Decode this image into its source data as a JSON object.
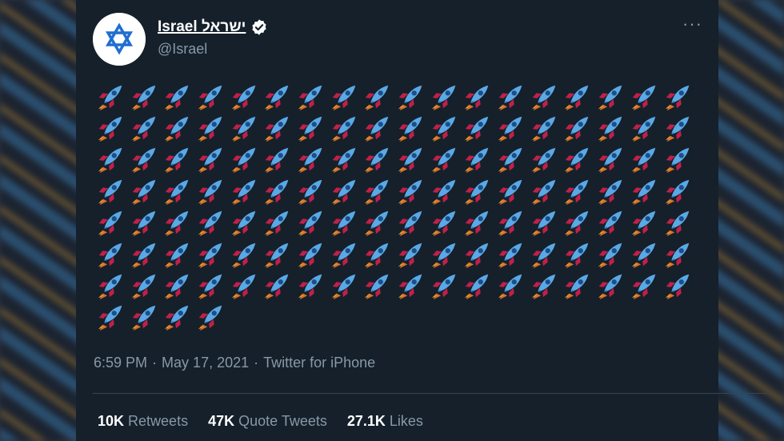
{
  "account": {
    "name": "Israel ישראל",
    "handle": "@Israel",
    "verified": true,
    "avatar_icon": "star-of-david-icon"
  },
  "menu": {
    "icon": "more-icon",
    "glyph": "···"
  },
  "tweet": {
    "emoji": "🚀",
    "emoji_icon": "rocket-icon",
    "emoji_count": 130,
    "time": "6:59 PM",
    "date": "May 17, 2021",
    "source": "Twitter for iPhone",
    "separator": "·"
  },
  "stats": [
    {
      "value": "10K",
      "label": "Retweets"
    },
    {
      "value": "47K",
      "label": "Quote Tweets"
    },
    {
      "value": "27.1K",
      "label": "Likes"
    }
  ],
  "colors": {
    "card_background": "#15202b",
    "text_primary": "#ffffff",
    "text_secondary": "#8899a6",
    "israel_blue": "#1f6fd1"
  }
}
